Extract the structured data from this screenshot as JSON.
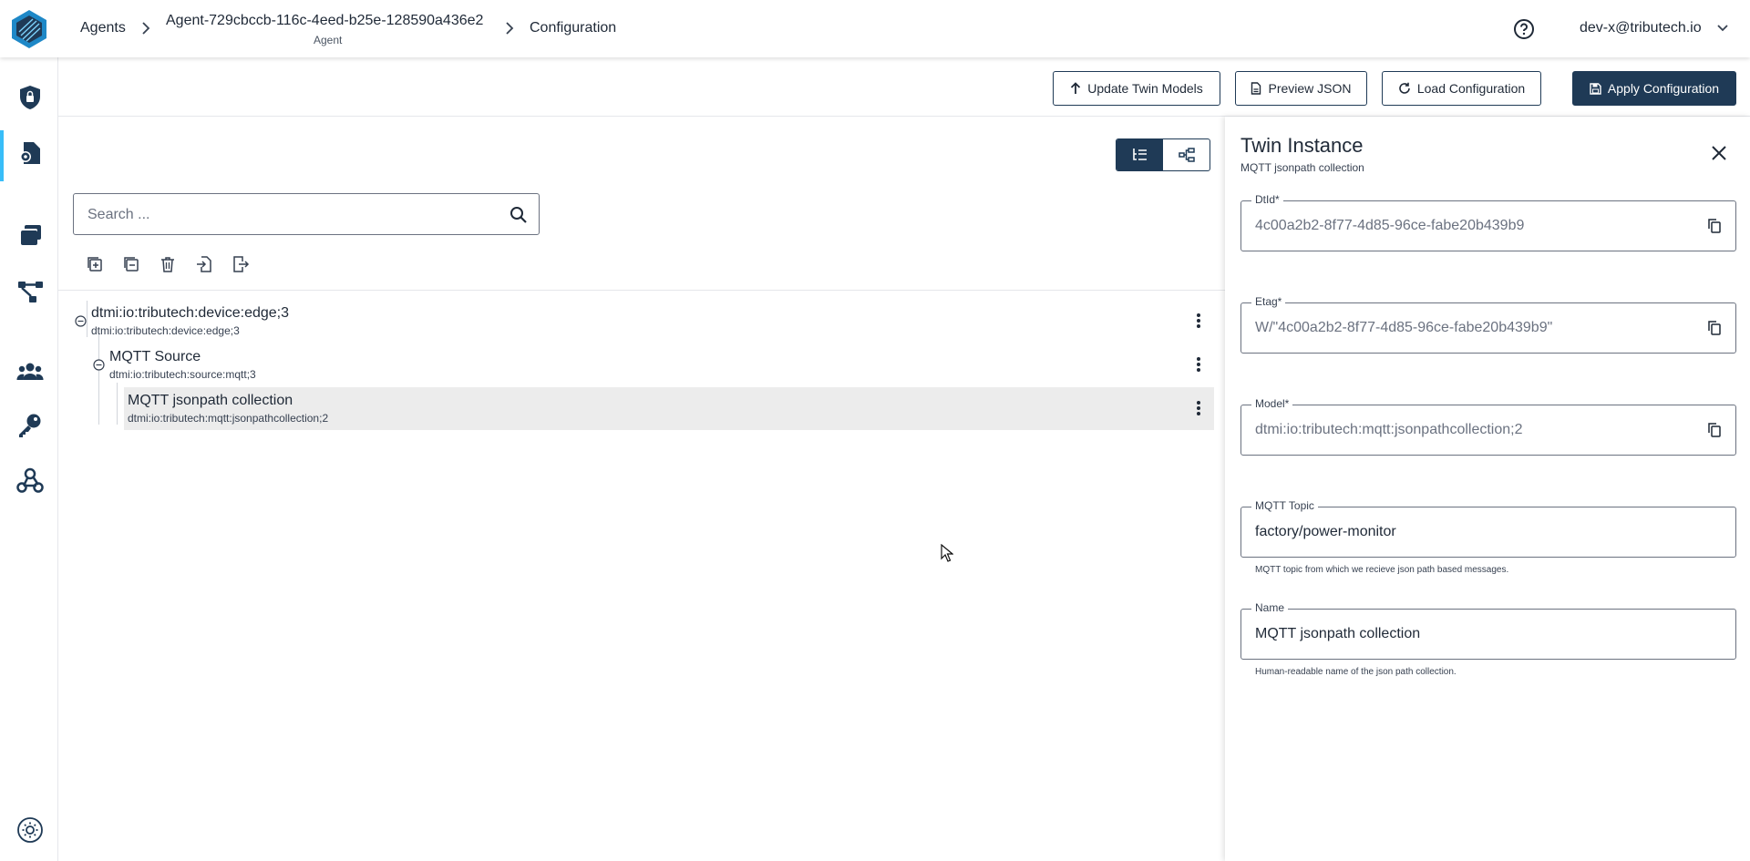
{
  "header": {
    "breadcrumb": {
      "agents": "Agents",
      "agent_id": "Agent-729cbccb-116c-4eed-b25e-128590a436e2",
      "agent_type": "Agent",
      "configuration": "Configuration"
    },
    "user": "dev-x@tributech.io"
  },
  "sidebar": {
    "items": [
      {
        "icon": "shield-lock-icon",
        "active": true
      },
      {
        "icon": "file-settings-icon"
      },
      {
        "icon": "stacked-cards-icon"
      },
      {
        "icon": "network-nodes-icon"
      },
      {
        "icon": "users-icon"
      },
      {
        "icon": "key-icon"
      },
      {
        "icon": "webhook-icon"
      }
    ],
    "theme_toggle_icon": "sun-icon"
  },
  "toolbar": {
    "update_twin_models": "Update Twin Models",
    "preview_json": "Preview JSON",
    "load_configuration": "Load Configuration",
    "apply_configuration": "Apply Configuration"
  },
  "search": {
    "placeholder": "Search ..."
  },
  "tree": {
    "nodes": [
      {
        "title": "dtmi:io:tributech:device:edge;3",
        "subtitle": "dtmi:io:tributech:device:edge;3"
      },
      {
        "title": "MQTT Source",
        "subtitle": "dtmi:io:tributech:source:mqtt;3"
      },
      {
        "title": "MQTT jsonpath collection",
        "subtitle": "dtmi:io:tributech:mqtt:jsonpathcollection;2",
        "selected": true
      }
    ]
  },
  "panel": {
    "title": "Twin Instance",
    "subtitle": "MQTT jsonpath collection",
    "fields": [
      {
        "label": "DtId*",
        "value": "4c00a2b2-8f77-4d85-96ce-fabe20b439b9",
        "readonly": true
      },
      {
        "label": "Etag*",
        "value": "W/\"4c00a2b2-8f77-4d85-96ce-fabe20b439b9\"",
        "readonly": true
      },
      {
        "label": "Model*",
        "value": "dtmi:io:tributech:mqtt:jsonpathcollection;2",
        "readonly": true
      },
      {
        "label": "MQTT Topic",
        "value": "factory/power-monitor",
        "hint": "MQTT topic from which we recieve json path based messages."
      },
      {
        "label": "Name",
        "value": "MQTT jsonpath collection",
        "hint": "Human-readable name of the json path collection."
      }
    ]
  },
  "colors": {
    "primary": "#1f3a56",
    "accent": "#38bdf8",
    "selected_row": "#ececec"
  }
}
